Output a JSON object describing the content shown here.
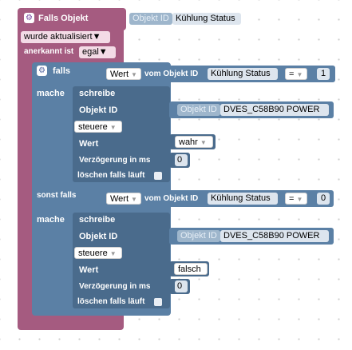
{
  "trigger": {
    "header": "Falls Objekt",
    "object_id_label": "Objekt ID",
    "object_id_value": "Kühlung Status",
    "event_option": "wurde aktualisiert",
    "ack_label": "anerkannt ist",
    "ack_option": "egal"
  },
  "if_block": {
    "if_label": "falls",
    "else_if_label": "sonst falls",
    "do_label": "mache",
    "conditions": [
      {
        "attr": "Wert",
        "from_label": "vom Objekt ID",
        "object": "Kühlung Status",
        "op": "=",
        "value": "1"
      },
      {
        "attr": "Wert",
        "from_label": "vom Objekt ID",
        "object": "Kühlung Status",
        "op": "=",
        "value": "0"
      }
    ],
    "actions": [
      {
        "title": "schreibe",
        "object_id_label": "Objekt ID",
        "object_field_label": "Objekt ID",
        "object_value": "DVES_C58B90 POWER",
        "mode": "steuere",
        "value_label": "Wert",
        "value": "wahr",
        "delay_label": "Verzögerung in ms",
        "delay": "0",
        "clear_label": "löschen falls läuft"
      },
      {
        "title": "schreibe",
        "object_id_label": "Objekt ID",
        "object_field_label": "Objekt ID",
        "object_value": "DVES_C58B90 POWER",
        "mode": "steuere",
        "value_label": "Wert",
        "value": "falsch",
        "delay_label": "Verzögerung in ms",
        "delay": "0",
        "clear_label": "löschen falls läuft"
      }
    ]
  }
}
